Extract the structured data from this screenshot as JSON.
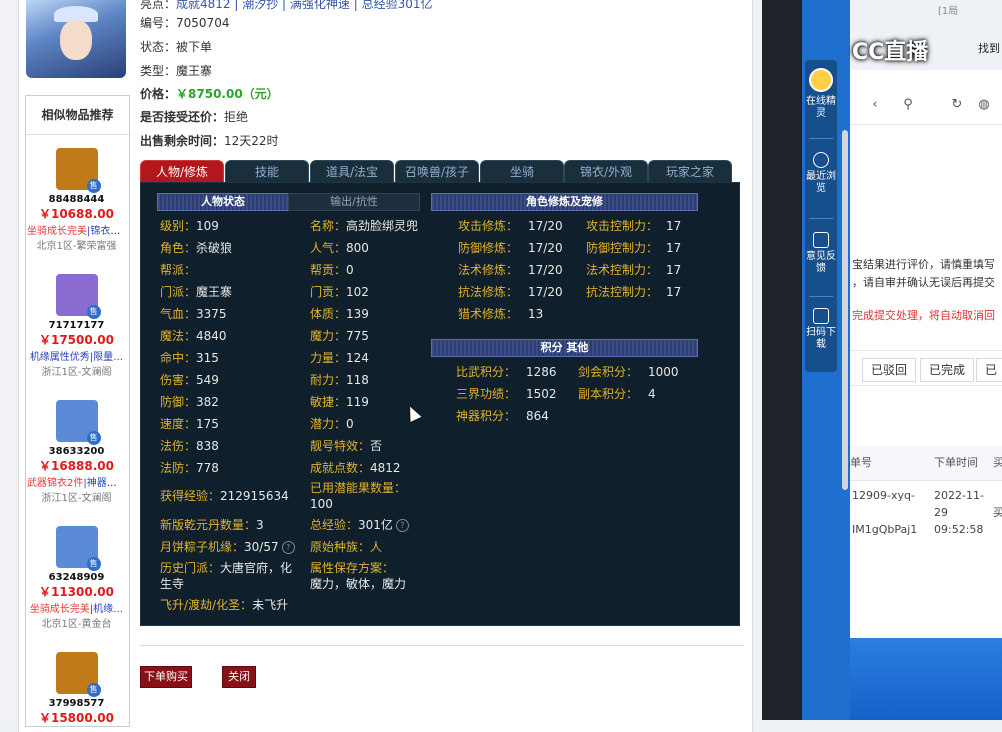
{
  "top": {
    "link_text": "成就4812 | 潮汐抄 | 满强化神速 | 总经验301亿",
    "fields": [
      {
        "k": "编号：",
        "v": "7050704"
      },
      {
        "k": "状态：",
        "v": "被下单"
      },
      {
        "k": "类型：",
        "v": "魔王寨"
      },
      {
        "k": "价格：",
        "v": "￥8750.00（元）"
      },
      {
        "k": "是否接受还价：",
        "v": "拒绝"
      },
      {
        "k": "出售剩余时间：",
        "v": "12天22时"
      }
    ]
  },
  "sidebar": {
    "title": "相似物品推荐",
    "sold_badge": "售",
    "items": [
      {
        "id": "88488444",
        "price": "￥10688.00",
        "tag1": "坐骑成长完美",
        "tag2": "|锦衣各…",
        "server": "北京1区-繁荣富强",
        "color": "#c07a1a"
      },
      {
        "id": "71717177",
        "price": "￥17500.00",
        "tag1": "机缘属性优秀",
        "tag2": "|限量…",
        "server": "浙江1区-文澜阁",
        "color": "#8a6bd1"
      },
      {
        "id": "38633200",
        "price": "￥16888.00",
        "tag1": "武器锦衣2件",
        "tag2": "|神器五…",
        "server": "浙江1区-文澜阁",
        "color": "#5a8ad8"
      },
      {
        "id": "63248909",
        "price": "￥11300.00",
        "tag1": "坐骑成长完美",
        "tag2": "|机缘…",
        "server": "北京1区-黄金台",
        "color": "#5a8ad8"
      },
      {
        "id": "37998577",
        "price": "￥15800.00",
        "tag1": "",
        "tag2": "",
        "server": "",
        "color": "#c07a1a"
      }
    ]
  },
  "tabs": [
    "人物/修炼",
    "技能",
    "道具/法宝",
    "召唤兽/孩子",
    "坐骑",
    "锦衣/外观",
    "玩家之家"
  ],
  "panel": {
    "hdr_status": "人物状态",
    "hdr_output": "输出/抗性",
    "hdr_cultivation": "角色修炼及宠修",
    "hdr_points": "积分 其他",
    "col1": [
      {
        "lb": "级别：",
        "vl": "109"
      },
      {
        "lb": "角色：",
        "vl": "杀破狼"
      },
      {
        "lb": "帮派：",
        "vl": ""
      },
      {
        "lb": "门派：",
        "vl": "魔王寨"
      },
      {
        "lb": "气血：",
        "vl": "3375"
      },
      {
        "lb": "魔法：",
        "vl": "4840"
      },
      {
        "lb": "命中：",
        "vl": "315"
      },
      {
        "lb": "伤害：",
        "vl": "549"
      },
      {
        "lb": "防御：",
        "vl": "382"
      },
      {
        "lb": "速度：",
        "vl": "175"
      },
      {
        "lb": "法伤：",
        "vl": "838"
      },
      {
        "lb": "法防：",
        "vl": "778"
      }
    ],
    "col2": [
      {
        "lb": "名称：",
        "vl": "高劲脸绑灵兜"
      },
      {
        "lb": "人气：",
        "vl": "800"
      },
      {
        "lb": "帮贡：",
        "vl": "0"
      },
      {
        "lb": "门贡：",
        "vl": "102"
      },
      {
        "lb": "体质：",
        "vl": "139"
      },
      {
        "lb": "魔力：",
        "vl": "775"
      },
      {
        "lb": "力量：",
        "vl": "124"
      },
      {
        "lb": "耐力：",
        "vl": "118"
      },
      {
        "lb": "敏捷：",
        "vl": "119"
      },
      {
        "lb": "潜力：",
        "vl": "0"
      },
      {
        "lb": "靓号特效：",
        "vl": "否"
      },
      {
        "lb": "成就点数：",
        "vl": "4812"
      }
    ],
    "extra": {
      "exp_lb": "获得经验：",
      "exp_vl": "212915634",
      "used_lb": "已用潜能果数量：",
      "used_vl": "100",
      "qk_lb": "新版乾元丹数量：",
      "qk_vl": "3",
      "total_lb": "总经验：",
      "total_vl": "301亿",
      "yb_lb": "月饼粽子机缘：",
      "yb_vl": "30/57",
      "race_lb": "原始种族：",
      "race_vl": "人",
      "hist_lb": "历史门派：",
      "hist_vl": "大唐官府，化生寺",
      "attr_lb": "属性保存方案：",
      "attr_vl": "魔力，敏体，魔力",
      "fly_lb": "飞升/渡劫/化圣：",
      "fly_vl": "未飞升"
    },
    "cult_left": [
      {
        "lb": "攻击修炼：",
        "vl": "17/20"
      },
      {
        "lb": "防御修炼：",
        "vl": "17/20"
      },
      {
        "lb": "法术修炼：",
        "vl": "17/20"
      },
      {
        "lb": "抗法修炼：",
        "vl": "17/20"
      },
      {
        "lb": "猎术修炼：",
        "vl": "13"
      }
    ],
    "cult_right": [
      {
        "lb": "攻击控制力：",
        "vl": "17"
      },
      {
        "lb": "防御控制力：",
        "vl": "17"
      },
      {
        "lb": "法术控制力：",
        "vl": "17"
      },
      {
        "lb": "抗法控制力：",
        "vl": "17"
      }
    ],
    "points_left": [
      {
        "lb": "比武积分：",
        "vl": "1286"
      },
      {
        "lb": "三界功绩：",
        "vl": "1502"
      },
      {
        "lb": "神器积分：",
        "vl": "864"
      }
    ],
    "points_right": [
      {
        "lb": "剑会积分：",
        "vl": "1000"
      },
      {
        "lb": "副本积分：",
        "vl": "4"
      }
    ]
  },
  "buttons": {
    "buy": "下单购买",
    "close": "关闭"
  },
  "cc": {
    "logo": "CC直播",
    "rail": [
      "在线精灵",
      "最近浏览",
      "意见反馈",
      "扫码下载"
    ]
  },
  "right": {
    "top_text": "找到",
    "top_text2": "[1局",
    "line1": "宝结果进行评价，请慎重填写",
    "line2": "，请自审并确认无误后再提交",
    "line3": "完成提交处理，将自动取消回",
    "tabs": [
      "已驳回",
      "已完成",
      "已"
    ],
    "th1": "单号",
    "th2": "下单时间",
    "th3": "买",
    "row_id1": "12909-xyq-",
    "row_id2": "IM1gQbPaj1",
    "row_date1": "2022-11-",
    "row_date2": "29",
    "row_date3": "09:52:58",
    "row_buyer": "买"
  }
}
